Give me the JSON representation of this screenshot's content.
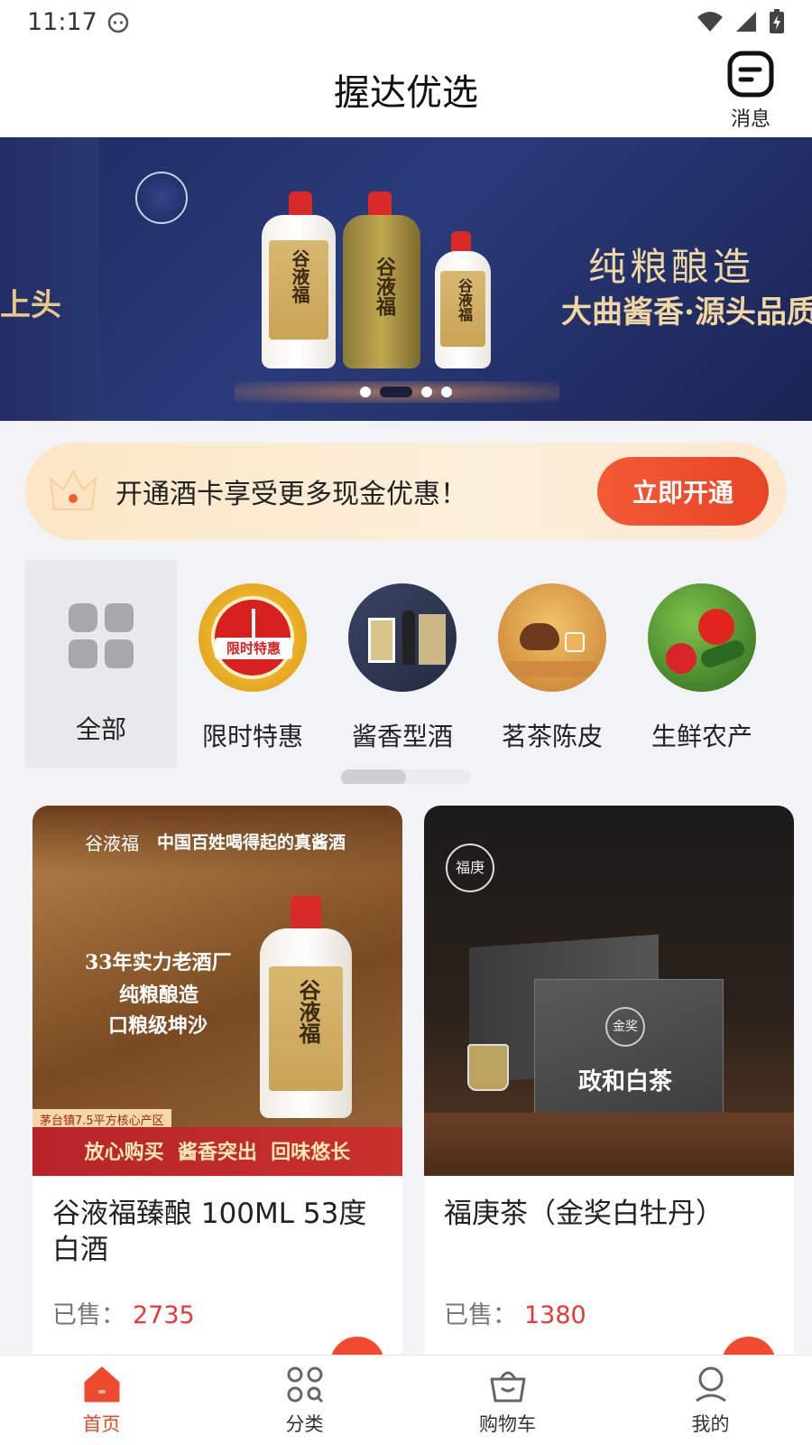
{
  "status_bar": {
    "time": "11:17"
  },
  "header": {
    "title": "握达优选",
    "message_label": "消息"
  },
  "banner": {
    "left_text": "上头",
    "headline": "纯粮酿造",
    "subline": "大曲酱香·源头品质",
    "bottle_text": "谷液福",
    "slide_count": 4,
    "active_slide": 2
  },
  "promo": {
    "text": "开通酒卡享受更多现金优惠！",
    "button_label": "立即开通"
  },
  "categories": [
    {
      "label": "全部",
      "icon": "grid-icon",
      "active": true
    },
    {
      "label": "限时特惠",
      "icon": "clock-badge-icon",
      "badge_text": "限时特惠"
    },
    {
      "label": "酱香型酒",
      "icon": "liquor-icon"
    },
    {
      "label": "茗茶陈皮",
      "icon": "tea-icon"
    },
    {
      "label": "生鲜农产",
      "icon": "vegetables-icon"
    }
  ],
  "products": [
    {
      "name": "谷液福臻酿 100ML 53度白酒",
      "sold_label": "已售：",
      "sold_count": "2735",
      "image": {
        "brand": "谷液福",
        "header": "中国百姓喝得起的真酱酒",
        "lines": [
          "33年实力老酒厂",
          "纯粮酿造",
          "口粮级坤沙"
        ],
        "tag": "茅台镇7.5平方核心产区",
        "footer": "放心购买  酱香突出  回味悠长"
      }
    },
    {
      "name": "福庚茶（金奖白牡丹）",
      "sold_label": "已售：",
      "sold_count": "1380",
      "image": {
        "logo": "福庚",
        "box_text": "政和白茶",
        "seal_text": "金奖"
      }
    }
  ],
  "bottom_nav": [
    {
      "label": "首页",
      "icon": "home-icon",
      "active": true
    },
    {
      "label": "分类",
      "icon": "category-icon"
    },
    {
      "label": "购物车",
      "icon": "cart-icon"
    },
    {
      "label": "我的",
      "icon": "user-icon"
    }
  ],
  "colors": {
    "accent": "#e64a2e",
    "price": "#e63a3a",
    "banner_bg": "#24316b",
    "gold": "#f0d6a0"
  }
}
